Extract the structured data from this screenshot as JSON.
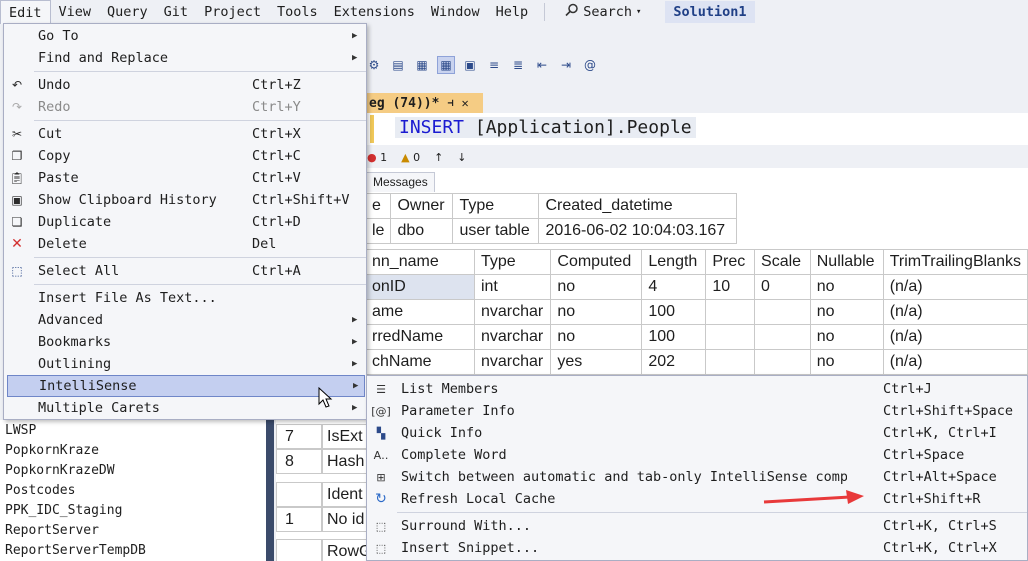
{
  "menubar": {
    "items": [
      "Edit",
      "View",
      "Query",
      "Git",
      "Project",
      "Tools",
      "Extensions",
      "Window",
      "Help"
    ],
    "search_label": "Search",
    "solution": "Solution1"
  },
  "editor": {
    "tab_title": "eg (74))*",
    "code_keyword": "INSERT",
    "code_rest": "[Application].People",
    "status_errors": "1",
    "status_warnings": "0"
  },
  "results": {
    "messages_tab": "Messages",
    "grid1": {
      "headers": [
        "e",
        "Owner",
        "Type",
        "Created_datetime"
      ],
      "row": [
        "le",
        "dbo",
        "user table",
        "2016-06-02 10:04:03.167"
      ]
    },
    "grid2": {
      "headers": [
        "nn_name",
        "Type",
        "Computed",
        "Length",
        "Prec",
        "Scale",
        "Nullable",
        "TrimTrailingBlanks"
      ],
      "rows": [
        [
          "onID",
          "int",
          "no",
          "4",
          "10",
          "0",
          "no",
          "(n/a)"
        ],
        [
          "ame",
          "nvarchar",
          "no",
          "100",
          "",
          "",
          "no",
          "(n/a)"
        ],
        [
          "rredName",
          "nvarchar",
          "no",
          "100",
          "",
          "",
          "no",
          "(n/a)"
        ],
        [
          "chName",
          "nvarchar",
          "yes",
          "202",
          "",
          "",
          "no",
          "(n/a)"
        ]
      ]
    },
    "bottom_rows": [
      {
        "num": "7",
        "text": "IsExt"
      },
      {
        "num": "8",
        "text": "Hash"
      },
      {
        "num": "",
        "text": "Ident"
      },
      {
        "num": "1",
        "text": "No id"
      },
      {
        "num": "",
        "text": "RowG"
      }
    ]
  },
  "object_list": [
    "LWSP",
    "PopkornKraze",
    "PopkornKrazeDW",
    "Postcodes",
    "PPK_IDC_Staging",
    "ReportServer",
    "ReportServerTempDB"
  ],
  "edit_menu": {
    "goto": {
      "label": "Go To",
      "icon": "none"
    },
    "find_replace": {
      "label": "Find and Replace"
    },
    "undo": {
      "label": "Undo",
      "shortcut": "Ctrl+Z",
      "icon": "undo-icon"
    },
    "redo": {
      "label": "Redo",
      "shortcut": "Ctrl+Y",
      "icon": "redo-icon"
    },
    "cut": {
      "label": "Cut",
      "shortcut": "Ctrl+X",
      "icon": "scissors-icon"
    },
    "copy": {
      "label": "Copy",
      "shortcut": "Ctrl+C",
      "icon": "copy-icon"
    },
    "paste": {
      "label": "Paste",
      "shortcut": "Ctrl+V",
      "icon": "paste-icon"
    },
    "clipboard_history": {
      "label": "Show Clipboard History",
      "shortcut": "Ctrl+Shift+V",
      "icon": "clipboard-icon"
    },
    "duplicate": {
      "label": "Duplicate",
      "shortcut": "Ctrl+D",
      "icon": "duplicate-icon"
    },
    "delete": {
      "label": "Delete",
      "shortcut": "Del",
      "icon": "delete-x-icon"
    },
    "select_all": {
      "label": "Select All",
      "shortcut": "Ctrl+A",
      "icon": "select-all-icon"
    },
    "insert_file": {
      "label": "Insert File As Text..."
    },
    "advanced": {
      "label": "Advanced"
    },
    "bookmarks": {
      "label": "Bookmarks"
    },
    "outlining": {
      "label": "Outlining"
    },
    "intellisense": {
      "label": "IntelliSense"
    },
    "multiple_carets": {
      "label": "Multiple Carets"
    }
  },
  "intellisense_menu": {
    "list_members": {
      "label": "List Members",
      "shortcut": "Ctrl+J"
    },
    "parameter_info": {
      "label": "Parameter Info",
      "shortcut": "Ctrl+Shift+Space"
    },
    "quick_info": {
      "label": "Quick Info",
      "shortcut": "Ctrl+K, Ctrl+I"
    },
    "complete_word": {
      "label": "Complete Word",
      "shortcut": "Ctrl+Space"
    },
    "switch_mode": {
      "label": "Switch between automatic and tab-only IntelliSense compl",
      "shortcut": "Ctrl+Alt+Space"
    },
    "refresh_cache": {
      "label": "Refresh Local Cache",
      "shortcut": "Ctrl+Shift+R"
    },
    "surround_with": {
      "label": "Surround With...",
      "shortcut": "Ctrl+K, Ctrl+S"
    },
    "insert_snippet": {
      "label": "Insert Snippet...",
      "shortcut": "Ctrl+K, Ctrl+X"
    }
  },
  "colors": {
    "menu_bg": "#f5f6f9",
    "highlight": "#c4cff0",
    "tab_active": "#f5cc84",
    "annotation_arrow": "#e8393a"
  }
}
